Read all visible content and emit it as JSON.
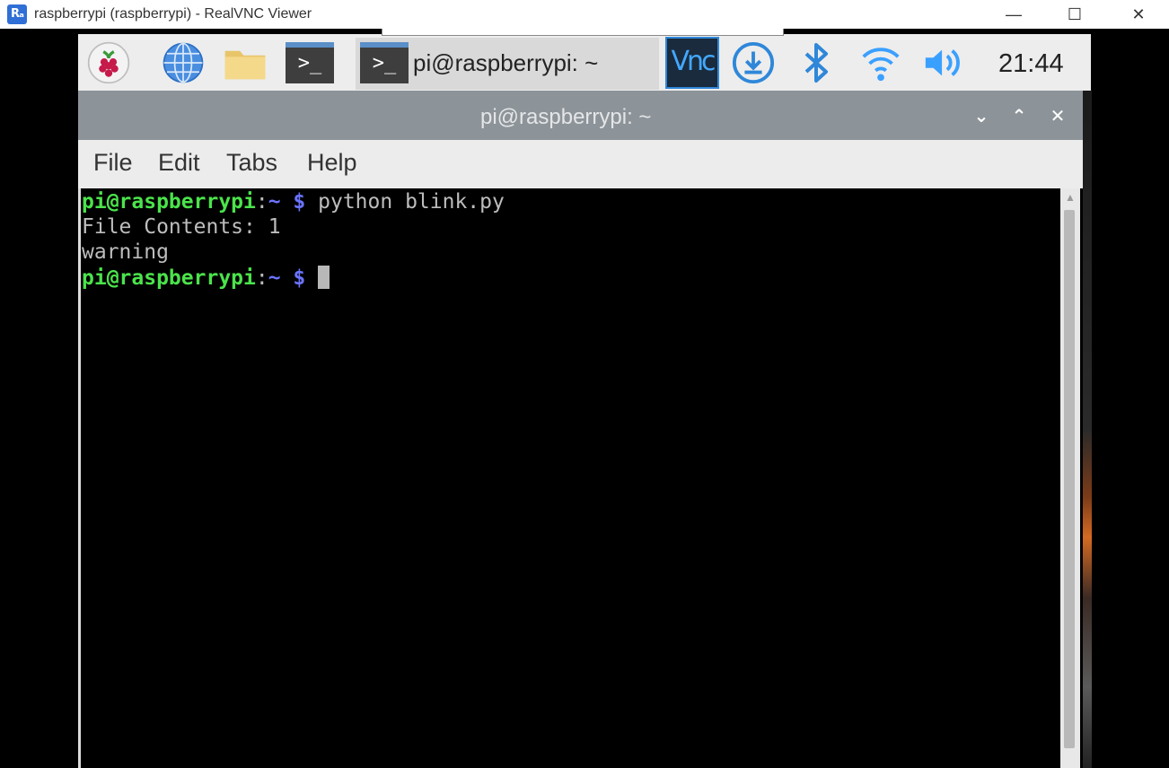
{
  "window": {
    "app_icon_text": "Rₐ",
    "title": "raspberrypi (raspberrypi) - RealVNC Viewer",
    "minimize_glyph": "—",
    "maximize_glyph": "☐",
    "close_glyph": "✕"
  },
  "taskbar": {
    "icons": [
      "raspberry-menu-icon",
      "web-browser-icon",
      "file-manager-icon",
      "terminal-icon"
    ],
    "active_task": {
      "icon": "terminal-icon",
      "label": "pi@raspberrypi: ~"
    },
    "tray": [
      "vnc-icon",
      "download-icon",
      "bluetooth-icon",
      "wifi-icon",
      "volume-icon"
    ],
    "clock": "21:44",
    "terminal_glyph": ">_",
    "vnc_text": "Vnc"
  },
  "terminal": {
    "title": "pi@raspberrypi: ~",
    "controls": {
      "minimize": "⌄",
      "maximize": "⌃",
      "close": "✕"
    },
    "menu": [
      "File",
      "Edit",
      "Tabs",
      "Help"
    ],
    "prompt": {
      "user": "pi@raspberrypi",
      "colon": ":",
      "path": "~ $"
    },
    "lines": {
      "command": "python blink.py",
      "output_1": "File Contents: 1",
      "output_2": "warning"
    }
  },
  "colors": {
    "prompt_user": "#4be34b",
    "prompt_path": "#6b74ff",
    "titlebar": "#8d9499",
    "accent_blue": "#2f87d9"
  }
}
